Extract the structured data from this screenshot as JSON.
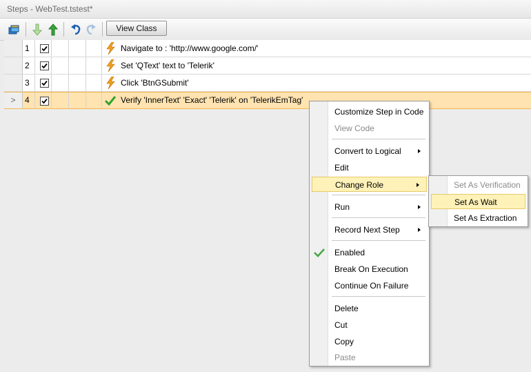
{
  "window": {
    "title": "Steps - WebTest.tstest*"
  },
  "toolbar": {
    "view_class_label": "View Class",
    "icons": [
      "layers-icon",
      "move-down-arrow-icon",
      "move-up-arrow-icon",
      "undo-icon",
      "redo-icon"
    ]
  },
  "steps": [
    {
      "num": "1",
      "row_header": "",
      "checked": true,
      "icon": "lightning-icon",
      "text": "Navigate to : 'http://www.google.com/'"
    },
    {
      "num": "2",
      "row_header": "",
      "checked": true,
      "icon": "lightning-icon",
      "text": "Set 'QText' text to 'Telerik'"
    },
    {
      "num": "3",
      "row_header": "",
      "checked": true,
      "icon": "lightning-icon",
      "text": "Click 'BtnGSubmit'"
    },
    {
      "num": "4",
      "row_header": ">",
      "checked": true,
      "icon": "green-check-icon",
      "text": "Verify 'InnerText' 'Exact' 'Telerik' on 'TelerikEmTag'",
      "selected": true
    }
  ],
  "context_menu": {
    "items": [
      {
        "label": "Customize Step in Code"
      },
      {
        "label": "View Code",
        "disabled": true
      },
      {
        "label": "Convert to Logical",
        "submenu": true
      },
      {
        "label": "Edit"
      },
      {
        "label": "Change Role",
        "submenu": true,
        "highlighted": true
      },
      {
        "label": "Run",
        "submenu": true
      },
      {
        "label": "Record Next Step",
        "submenu": true
      },
      {
        "label": "Enabled",
        "checked": true
      },
      {
        "label": "Break On Execution"
      },
      {
        "label": "Continue On Failure"
      },
      {
        "label": "Delete"
      },
      {
        "label": "Cut"
      },
      {
        "label": "Copy"
      },
      {
        "label": "Paste",
        "disabled": true
      }
    ]
  },
  "submenu": {
    "items": [
      {
        "label": "Set As Verification",
        "disabled": true
      },
      {
        "label": "Set As Wait",
        "highlighted": true
      },
      {
        "label": "Set As Extraction"
      }
    ]
  },
  "colors": {
    "selected_row": "#ffe3b0",
    "highlight": "#fff2b8",
    "bolt": "#f0a020",
    "check": "#2ea52e"
  }
}
